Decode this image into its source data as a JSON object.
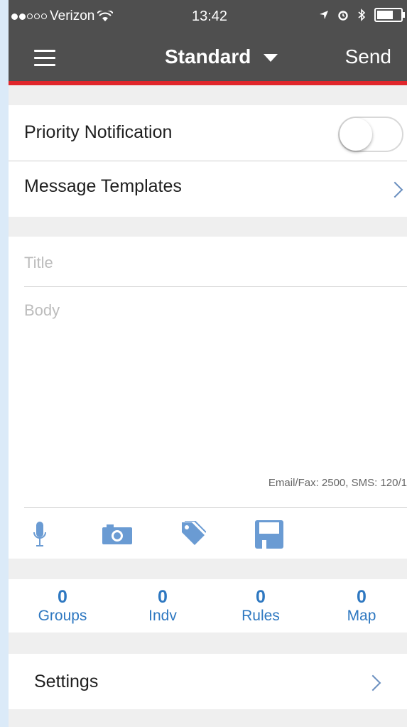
{
  "status_bar": {
    "carrier": "Verizon",
    "time": "13:42"
  },
  "nav": {
    "title": "Standard",
    "send_label": "Send"
  },
  "priority": {
    "label": "Priority Notification",
    "enabled": false
  },
  "templates": {
    "label": "Message Templates"
  },
  "compose": {
    "title_placeholder": "Title",
    "body_placeholder": "Body",
    "limit_text": "Email/Fax: 2500, SMS: 120/1"
  },
  "toolbar": {
    "icons": [
      "microphone-icon",
      "camera-icon",
      "tag-icon",
      "save-icon"
    ]
  },
  "counts": [
    {
      "value": "0",
      "label": "Groups"
    },
    {
      "value": "0",
      "label": "Indv"
    },
    {
      "value": "0",
      "label": "Rules"
    },
    {
      "value": "0",
      "label": "Map"
    }
  ],
  "settings": {
    "label": "Settings"
  },
  "colors": {
    "nav_bg": "#4f4f4f",
    "accent_red": "#e0262b",
    "link_blue": "#2e78c1",
    "icon_blue": "#6a9bd3"
  }
}
